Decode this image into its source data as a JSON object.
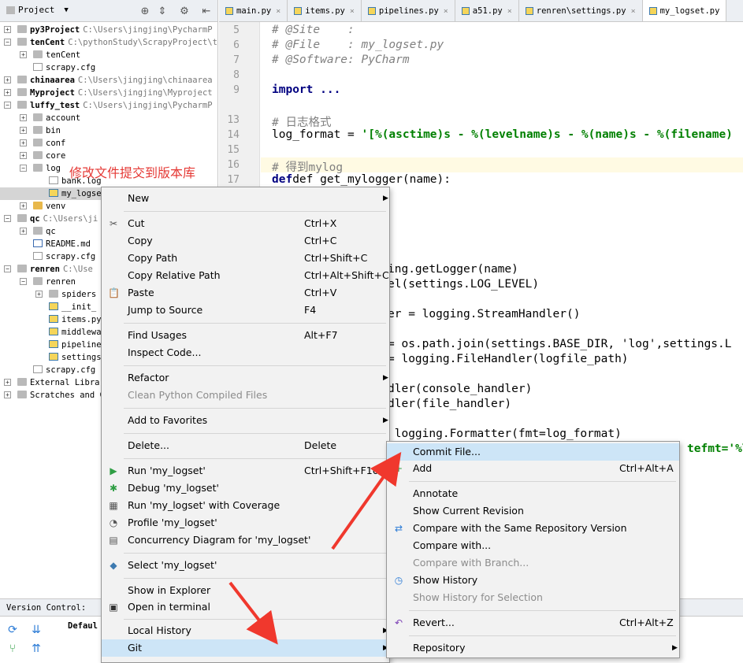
{
  "project": {
    "title": "Project",
    "tree": [
      {
        "name": "py3Project",
        "path": "C:\\Users\\jingjing\\PycharmP",
        "bold": true
      },
      {
        "name": "tenCent",
        "path": "C:\\pythonStudy\\ScrapyProject\\t",
        "bold": true
      },
      {
        "name": "tenCent",
        "path": ""
      },
      {
        "name": "scrapy.cfg",
        "path": ""
      },
      {
        "name": "chinaarea",
        "path": "C:\\Users\\jingjing\\chinaarea",
        "bold": true
      },
      {
        "name": "Myproject",
        "path": "C:\\Users\\jingjing\\Myproject",
        "bold": true
      },
      {
        "name": "luffy_test",
        "path": "C:\\Users\\jingjing\\PycharmP",
        "bold": true
      },
      {
        "name": "account",
        "path": ""
      },
      {
        "name": "bin",
        "path": ""
      },
      {
        "name": "conf",
        "path": ""
      },
      {
        "name": "core",
        "path": ""
      },
      {
        "name": "log",
        "path": ""
      },
      {
        "name": "bank.log",
        "path": ""
      },
      {
        "name": "my_logse",
        "path": ""
      },
      {
        "name": "venv",
        "path": ""
      },
      {
        "name": "qc",
        "path": "C:\\Users\\ji",
        "bold": true
      },
      {
        "name": "qc",
        "path": ""
      },
      {
        "name": "README.md",
        "path": ""
      },
      {
        "name": "scrapy.cfg",
        "path": ""
      },
      {
        "name": "renren",
        "path": "C:\\Use",
        "bold": true
      },
      {
        "name": "renren",
        "path": ""
      },
      {
        "name": "spiders",
        "path": ""
      },
      {
        "name": "__init_",
        "path": ""
      },
      {
        "name": "items.py",
        "path": ""
      },
      {
        "name": "middlewa",
        "path": ""
      },
      {
        "name": "pipeline",
        "path": ""
      },
      {
        "name": "settings",
        "path": ""
      },
      {
        "name": "scrapy.cfg",
        "path": ""
      },
      {
        "name": "External Libra",
        "path": ""
      },
      {
        "name": "Scratches and C",
        "path": ""
      }
    ],
    "annotation": "修改文件提交到版本库"
  },
  "tabs": [
    "main.py",
    "items.py",
    "pipelines.py",
    "a51.py",
    "renren\\settings.py",
    "my_logset.py"
  ],
  "editor": {
    "line_numbers": [
      "5",
      "6",
      "7",
      "8",
      "9",
      "13",
      "14",
      "15",
      "16",
      "17"
    ],
    "lines": [
      "# @Site    :",
      "# @File    : my_logset.py",
      "# @Software: PyCharm",
      "",
      "import ...",
      "# 日志格式",
      "log_format = ",
      "",
      "# 得到mylog",
      "def get_mylogger(name):"
    ],
    "log_format_string": "'[%(asctime)s - %(levelname)s - %(name)s - %(filename)",
    "partial_lines": [
      "ing.getLogger(name)",
      "el(settings.LOG_LEVEL)",
      "er = logging.StreamHandler()",
      "= os.path.join(settings.BASE_DIR, 'log',settings.L",
      "= logging.FileHandler(logfile_path)",
      "dler(console_handler)",
      "dler(file_handler)",
      " logging.Formatter(fmt=log_format)"
    ],
    "datefmt_fragment": "tefmt='%Y-"
  },
  "context_menu": {
    "items": [
      {
        "label": "New",
        "shortcut": "",
        "submenu": true
      },
      {
        "label": "Cut",
        "shortcut": "Ctrl+X",
        "icon": "scissors-icon"
      },
      {
        "label": "Copy",
        "shortcut": "Ctrl+C"
      },
      {
        "label": "Copy Path",
        "shortcut": "Ctrl+Shift+C"
      },
      {
        "label": "Copy Relative Path",
        "shortcut": "Ctrl+Alt+Shift+C"
      },
      {
        "label": "Paste",
        "shortcut": "Ctrl+V",
        "icon": "clipboard-icon"
      },
      {
        "label": "Jump to Source",
        "shortcut": "F4"
      },
      {
        "label": "Find Usages",
        "shortcut": "Alt+F7"
      },
      {
        "label": "Inspect Code...",
        "shortcut": ""
      },
      {
        "label": "Refactor",
        "shortcut": "",
        "submenu": true
      },
      {
        "label": "Clean Python Compiled Files",
        "shortcut": "",
        "disabled": true
      },
      {
        "label": "Add to Favorites",
        "shortcut": "",
        "submenu": true
      },
      {
        "label": "Delete...",
        "shortcut": "Delete"
      },
      {
        "label": "Run 'my_logset'",
        "shortcut": "Ctrl+Shift+F10",
        "icon": "run-icon"
      },
      {
        "label": "Debug 'my_logset'",
        "shortcut": "",
        "icon": "debug-icon"
      },
      {
        "label": "Run 'my_logset' with Coverage",
        "shortcut": "",
        "icon": "coverage-icon"
      },
      {
        "label": "Profile 'my_logset'",
        "shortcut": "",
        "icon": "profile-icon"
      },
      {
        "label": "Concurrency Diagram for 'my_logset'",
        "shortcut": "",
        "icon": "concurrency-icon"
      },
      {
        "label": "Select 'my_logset'",
        "shortcut": "",
        "icon": "python-icon"
      },
      {
        "label": "Show in Explorer",
        "shortcut": ""
      },
      {
        "label": "Open in terminal",
        "shortcut": "",
        "icon": "terminal-icon"
      },
      {
        "label": "Local History",
        "shortcut": "",
        "submenu": true
      },
      {
        "label": "Git",
        "shortcut": "",
        "submenu": true,
        "highlighted": true
      }
    ]
  },
  "git_menu": {
    "items": [
      {
        "label": "Commit File...",
        "shortcut": "",
        "highlighted": true
      },
      {
        "label": "Add",
        "shortcut": "Ctrl+Alt+A",
        "icon": "plus-icon"
      },
      {
        "label": "Annotate",
        "shortcut": ""
      },
      {
        "label": "Show Current Revision",
        "shortcut": ""
      },
      {
        "label": "Compare with the Same Repository Version",
        "shortcut": "",
        "icon": "compare-icon"
      },
      {
        "label": "Compare with...",
        "shortcut": ""
      },
      {
        "label": "Compare with Branch...",
        "shortcut": "",
        "disabled": true
      },
      {
        "label": "Show History",
        "shortcut": "",
        "icon": "history-icon"
      },
      {
        "label": "Show History for Selection",
        "shortcut": "",
        "disabled": true
      },
      {
        "label": "Revert...",
        "shortcut": "Ctrl+Alt+Z",
        "icon": "revert-icon"
      },
      {
        "label": "Repository",
        "shortcut": "",
        "submenu": true
      }
    ]
  },
  "version_control": {
    "title": "Version Control:",
    "default_label": "Defaul"
  },
  "colors": {
    "menu_highlight": "#cde5f7",
    "annotation_red": "#e53935",
    "arrow_red": "#f0382d"
  }
}
